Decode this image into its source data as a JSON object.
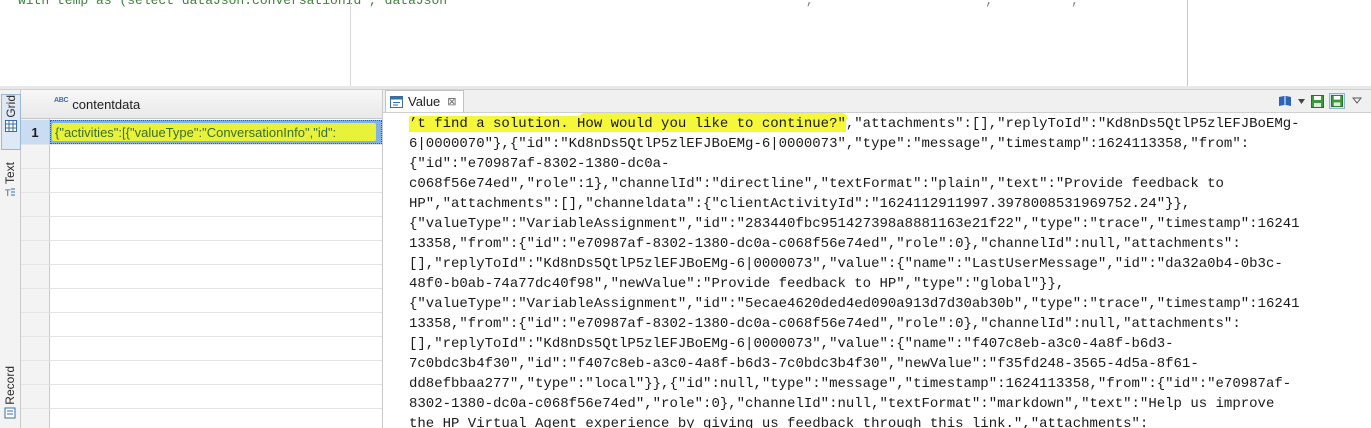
{
  "sql_editor": {
    "line_visible": "with temp as (select dataJson.conversationId , dataJson",
    "line_tail": "                                              ,                      ,          ,                           )"
  },
  "left_tabs": [
    {
      "label": "Grid",
      "icon": "grid-icon",
      "active": true
    },
    {
      "label": "Text",
      "icon": "text-icon",
      "active": false
    },
    {
      "label": "Record",
      "icon": "record-icon",
      "active": false
    }
  ],
  "grid": {
    "column_type_badge": "ABC",
    "column_header": "contentdata",
    "rows": [
      {
        "num": "1",
        "value": "{\"activities\":[{\"valueType\":\"ConversationInfo\",\"id\":"
      }
    ]
  },
  "value_panel": {
    "tab_label": "Value",
    "tab_close": "⊠",
    "highlight_color": "#f4f73a",
    "lines": [
      {
        "hl": "’t find a solution. How would you like to continue?\"",
        "text": ",\"attachments\":[],\"replyToId\":\"Kd8nDs5QtlP5zlEFJBoEMg-"
      },
      {
        "hl": "",
        "text": "6|0000070\"},{\"id\":\"Kd8nDs5QtlP5zlEFJBoEMg-6|0000073\",\"type\":\"message\",\"timestamp\":1624113358,\"from\":"
      },
      {
        "hl": "",
        "text": "{\"id\":\"e70987af-8302-1380-dc0a-"
      },
      {
        "hl": "",
        "text": "c068f56e74ed\",\"role\":1},\"channelId\":\"directline\",\"textFormat\":\"plain\",\"text\":\"Provide feedback to"
      },
      {
        "hl": "",
        "text": "HP\",\"attachments\":[],\"channeldata\":{\"clientActivityId\":\"1624112911997.3978008531969752.24\"}},"
      },
      {
        "hl": "",
        "text": "{\"valueType\":\"VariableAssignment\",\"id\":\"283440fbc951427398a8881163e21f22\",\"type\":\"trace\",\"timestamp\":16241"
      },
      {
        "hl": "",
        "text": "13358,\"from\":{\"id\":\"e70987af-8302-1380-dc0a-c068f56e74ed\",\"role\":0},\"channelId\":null,\"attachments\":"
      },
      {
        "hl": "",
        "text": "[],\"replyToId\":\"Kd8nDs5QtlP5zlEFJBoEMg-6|0000073\",\"value\":{\"name\":\"LastUserMessage\",\"id\":\"da32a0b4-0b3c-"
      },
      {
        "hl": "",
        "text": "48f0-b0ab-74a77dc40f98\",\"newValue\":\"Provide feedback to HP\",\"type\":\"global\"}},"
      },
      {
        "hl": "",
        "text": "{\"valueType\":\"VariableAssignment\",\"id\":\"5ecae4620ded4ed090a913d7d30ab30b\",\"type\":\"trace\",\"timestamp\":16241"
      },
      {
        "hl": "",
        "text": "13358,\"from\":{\"id\":\"e70987af-8302-1380-dc0a-c068f56e74ed\",\"role\":0},\"channelId\":null,\"attachments\":"
      },
      {
        "hl": "",
        "text": "[],\"replyToId\":\"Kd8nDs5QtlP5zlEFJBoEMg-6|0000073\",\"value\":{\"name\":\"f407c8eb-a3c0-4a8f-b6d3-"
      },
      {
        "hl": "",
        "text": "7c0bdc3b4f30\",\"id\":\"f407c8eb-a3c0-4a8f-b6d3-7c0bdc3b4f30\",\"newValue\":\"f35fd248-3565-4d5a-8f61-"
      },
      {
        "hl": "",
        "text": "dd8efbbaa277\",\"type\":\"local\"}},{\"id\":null,\"type\":\"message\",\"timestamp\":1624113358,\"from\":{\"id\":\"e70987af-"
      },
      {
        "hl": "",
        "text": "8302-1380-dc0a-c068f56e74ed\",\"role\":0},\"channelId\":null,\"textFormat\":\"markdown\",\"text\":\"Help us improve"
      },
      {
        "hl": "",
        "text": "the HP Virtual Agent experience by giving us feedback through this link.\",\"attachments\":"
      }
    ]
  },
  "toolbar_icons": [
    "book-icon",
    "save-green-icon",
    "save-pressed-icon",
    "view-menu-icon"
  ]
}
